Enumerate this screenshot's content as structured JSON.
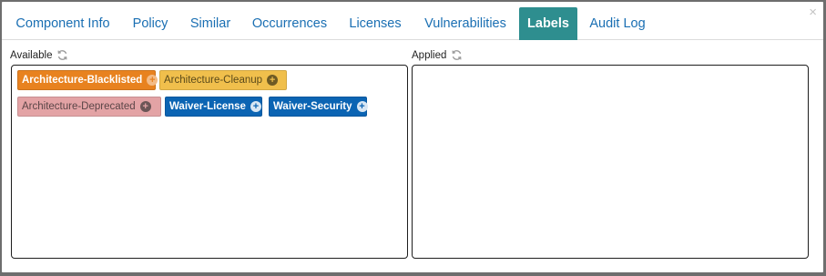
{
  "tabs": [
    {
      "label": "Component Info"
    },
    {
      "label": "Policy"
    },
    {
      "label": "Similar"
    },
    {
      "label": "Occurrences"
    },
    {
      "label": "Licenses"
    },
    {
      "label": "Vulnerabilities"
    },
    {
      "label": "Labels",
      "active": true
    },
    {
      "label": "Audit Log"
    }
  ],
  "close_glyph": "×",
  "available": {
    "title": "Available",
    "refresh_icon": "refresh-icon",
    "labels": [
      {
        "text": "Architecture-Blacklisted",
        "bg": "#e8821f",
        "fg": "#ffffff",
        "bold": true,
        "icon_bg": "#f3bb86",
        "icon_fg": "#e8821f"
      },
      {
        "text": "Architecture-Cleanup",
        "bg": "#f0bf4c",
        "fg": "#5a4a1a",
        "bold": false,
        "icon_bg": "#6e5a24",
        "icon_fg": "#f0bf4c"
      },
      {
        "text": "Architecture-Deprecated",
        "bg": "#e3a3a5",
        "fg": "#5a4547",
        "bold": false,
        "icon_bg": "#6b5556",
        "icon_fg": "#e3a3a5"
      },
      {
        "text": "Waiver-License",
        "bg": "#0b64b3",
        "fg": "#ffffff",
        "bold": true,
        "icon_bg": "#d8e6f3",
        "icon_fg": "#0b64b3"
      },
      {
        "text": "Waiver-Security",
        "bg": "#0b64b3",
        "fg": "#ffffff",
        "bold": true,
        "icon_bg": "#d8e6f3",
        "icon_fg": "#0b64b3"
      }
    ]
  },
  "applied": {
    "title": "Applied",
    "refresh_icon": "refresh-icon",
    "labels": []
  },
  "colors": {
    "tab_text": "#1a6fb3",
    "tab_active_bg": "#2e8e8f",
    "backdrop": "#6e6e6e"
  }
}
